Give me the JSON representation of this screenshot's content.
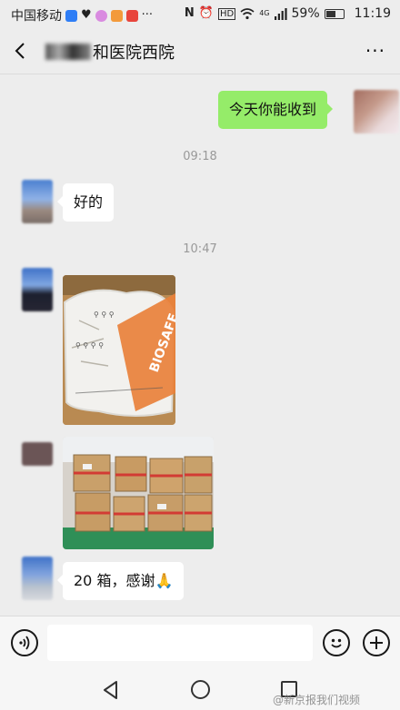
{
  "status_bar": {
    "carrier": "中国移动",
    "signal_label": "4G",
    "battery_percent": "59%",
    "battery_level": 0.59,
    "time": "11:19"
  },
  "header": {
    "title": "和医院西院"
  },
  "messages": [
    {
      "side": "right",
      "type": "text",
      "text": "今天你能收到"
    },
    {
      "type": "time",
      "text": "09:18"
    },
    {
      "side": "left",
      "type": "text",
      "text": "好的"
    },
    {
      "type": "time",
      "text": "10:47"
    },
    {
      "side": "left",
      "type": "image",
      "content": "package-photo",
      "print": "BIOSAFE"
    },
    {
      "side": "left",
      "type": "image",
      "content": "cartons-photo"
    },
    {
      "side": "left",
      "type": "text",
      "text": "20 箱，感谢🙏"
    }
  ],
  "input_bar": {
    "voice_icon": "voice-icon",
    "emoji_icon": "emoji-icon",
    "plus_icon": "plus-icon"
  },
  "nav_bar": {
    "watermark": "@新京报我们视频"
  },
  "colors": {
    "background": "#ededed",
    "sent_bubble": "#95ec69",
    "received_bubble": "#ffffff"
  }
}
